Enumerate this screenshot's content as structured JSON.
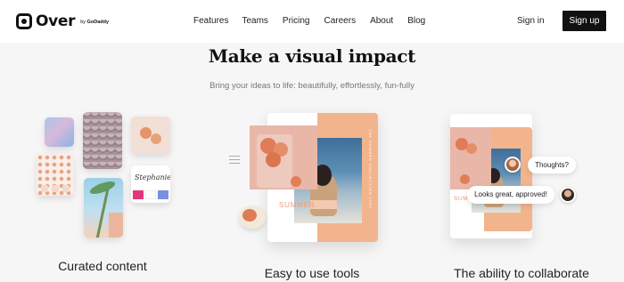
{
  "brand": {
    "name": "Over",
    "byline_prefix": "by",
    "byline_brand": "GoDaddy"
  },
  "nav": {
    "links": [
      "Features",
      "Teams",
      "Pricing",
      "Careers",
      "About",
      "Blog"
    ],
    "signin_label": "Sign in",
    "signup_label": "Sign up"
  },
  "hero": {
    "title": "Make a visual impact",
    "subtitle": "Bring your ideas to life: beautifully, effortlessly, fun-fully"
  },
  "features": [
    {
      "label": "Curated content",
      "tile_script_text": "Stephanie"
    },
    {
      "label": "Easy to use tools",
      "card_text": "SUMMER",
      "vertical_text": "THE SUMMER COLLECTION 2020"
    },
    {
      "label": "The ability to collaborate",
      "card_text": "SUMMER",
      "comment_1": "Thoughts?",
      "comment_2": "Looks great, approved!"
    }
  ],
  "colors": {
    "accent_peach": "#f2b48d",
    "button_dark": "#111111",
    "background": "#f7f6f6"
  }
}
